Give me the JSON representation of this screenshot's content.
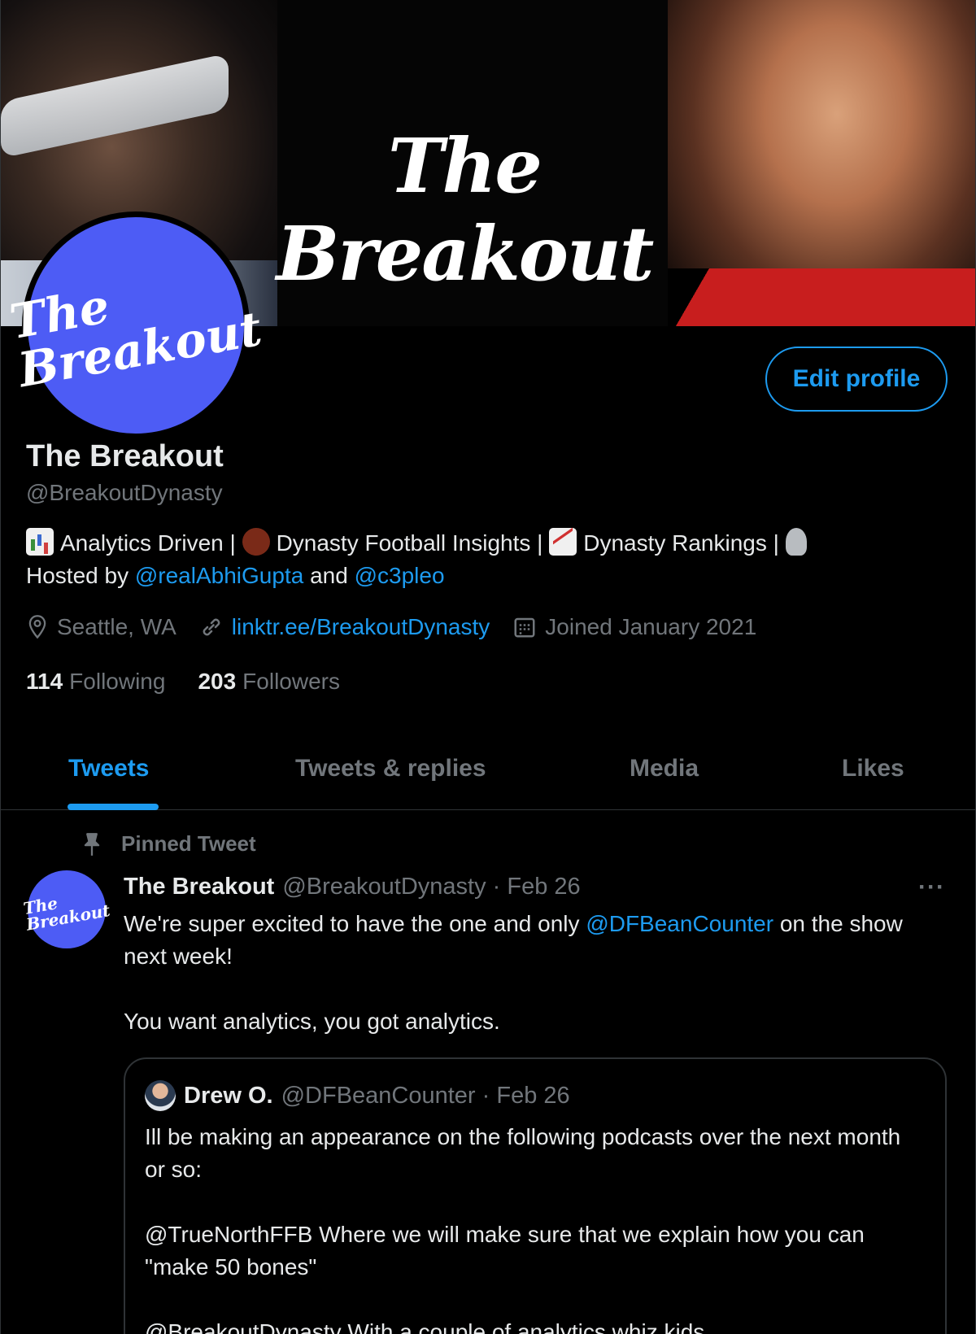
{
  "banner": {
    "title": "The Breakout"
  },
  "avatar": {
    "line1": "The",
    "line2": "Breakout"
  },
  "profile": {
    "edit_label": "Edit profile",
    "name": "The Breakout",
    "handle": "@BreakoutDynasty",
    "bio": {
      "seg1": "Analytics Driven | ",
      "seg2": "Dynasty Football Insights | ",
      "seg3": "Dynasty Rankings | ",
      "seg4": "Hosted by ",
      "mention1": "@realAbhiGupta",
      "seg5": " and ",
      "mention2": "@c3pleo"
    },
    "location": "Seattle, WA",
    "website": "linktr.ee/BreakoutDynasty",
    "joined": "Joined January 2021",
    "following_count": "114",
    "following_label": "Following",
    "followers_count": "203",
    "followers_label": "Followers"
  },
  "tabs": [
    {
      "label": "Tweets"
    },
    {
      "label": "Tweets & replies"
    },
    {
      "label": "Media"
    },
    {
      "label": "Likes"
    }
  ],
  "pinned_label": "Pinned Tweet",
  "tweet": {
    "avatar_line1": "The",
    "avatar_line2": "Breakout",
    "name": "The Breakout",
    "handle_date": "@BreakoutDynasty · Feb 26",
    "more": "···",
    "text1a": "We're super excited to have the one and only ",
    "mention": "@DFBeanCounter",
    "text1b": " on the show next week!",
    "text2": "You want analytics, you got analytics."
  },
  "quote": {
    "name": "Drew O.",
    "handle_date": "@DFBeanCounter · Feb 26",
    "p1": "Ill be making an appearance on the following podcasts over the next month or so:",
    "p2": "@TrueNorthFFB Where we will make sure that we explain how you can \"make 50 bones\"",
    "p3": "@BreakoutDynasty With a couple of analytics whiz kids"
  },
  "colors": {
    "accent": "#1d9bf0",
    "brand": "#4d5cf5",
    "background": "#000000",
    "muted": "#71767b"
  },
  "icons": [
    "location-icon",
    "link-icon",
    "calendar-icon",
    "pin-icon",
    "more-icon"
  ]
}
